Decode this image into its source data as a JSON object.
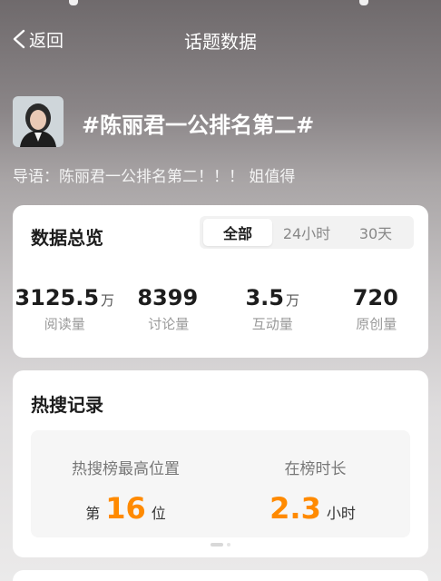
{
  "nav": {
    "back_label": "返回",
    "title": "话题数据"
  },
  "topic": {
    "title": "#陈丽君一公排名第二#",
    "lead": "导语：陈丽君一公排名第二！！！ 姐值得"
  },
  "overview": {
    "title": "数据总览",
    "tabs": [
      {
        "label": "全部",
        "active": true
      },
      {
        "label": "24小时",
        "active": false
      },
      {
        "label": "30天",
        "active": false
      }
    ],
    "stats": [
      {
        "value": "3125.5",
        "unit": "万",
        "label": "阅读量"
      },
      {
        "value": "8399",
        "unit": "",
        "label": "讨论量"
      },
      {
        "value": "3.5",
        "unit": "万",
        "label": "互动量"
      },
      {
        "value": "720",
        "unit": "",
        "label": "原创量"
      }
    ]
  },
  "hot": {
    "title": "热搜记录",
    "best_rank": {
      "label": "热搜榜最高位置",
      "prefix": "第",
      "value": "16",
      "suffix": "位"
    },
    "duration": {
      "label": "在榜时长",
      "value": "2.3",
      "suffix": "小时"
    }
  },
  "colors": {
    "accent_orange": "#ff8a00",
    "card_bg": "#ffffff"
  },
  "icons": {
    "back": "chevron-left-icon",
    "avatar": "avatar"
  }
}
